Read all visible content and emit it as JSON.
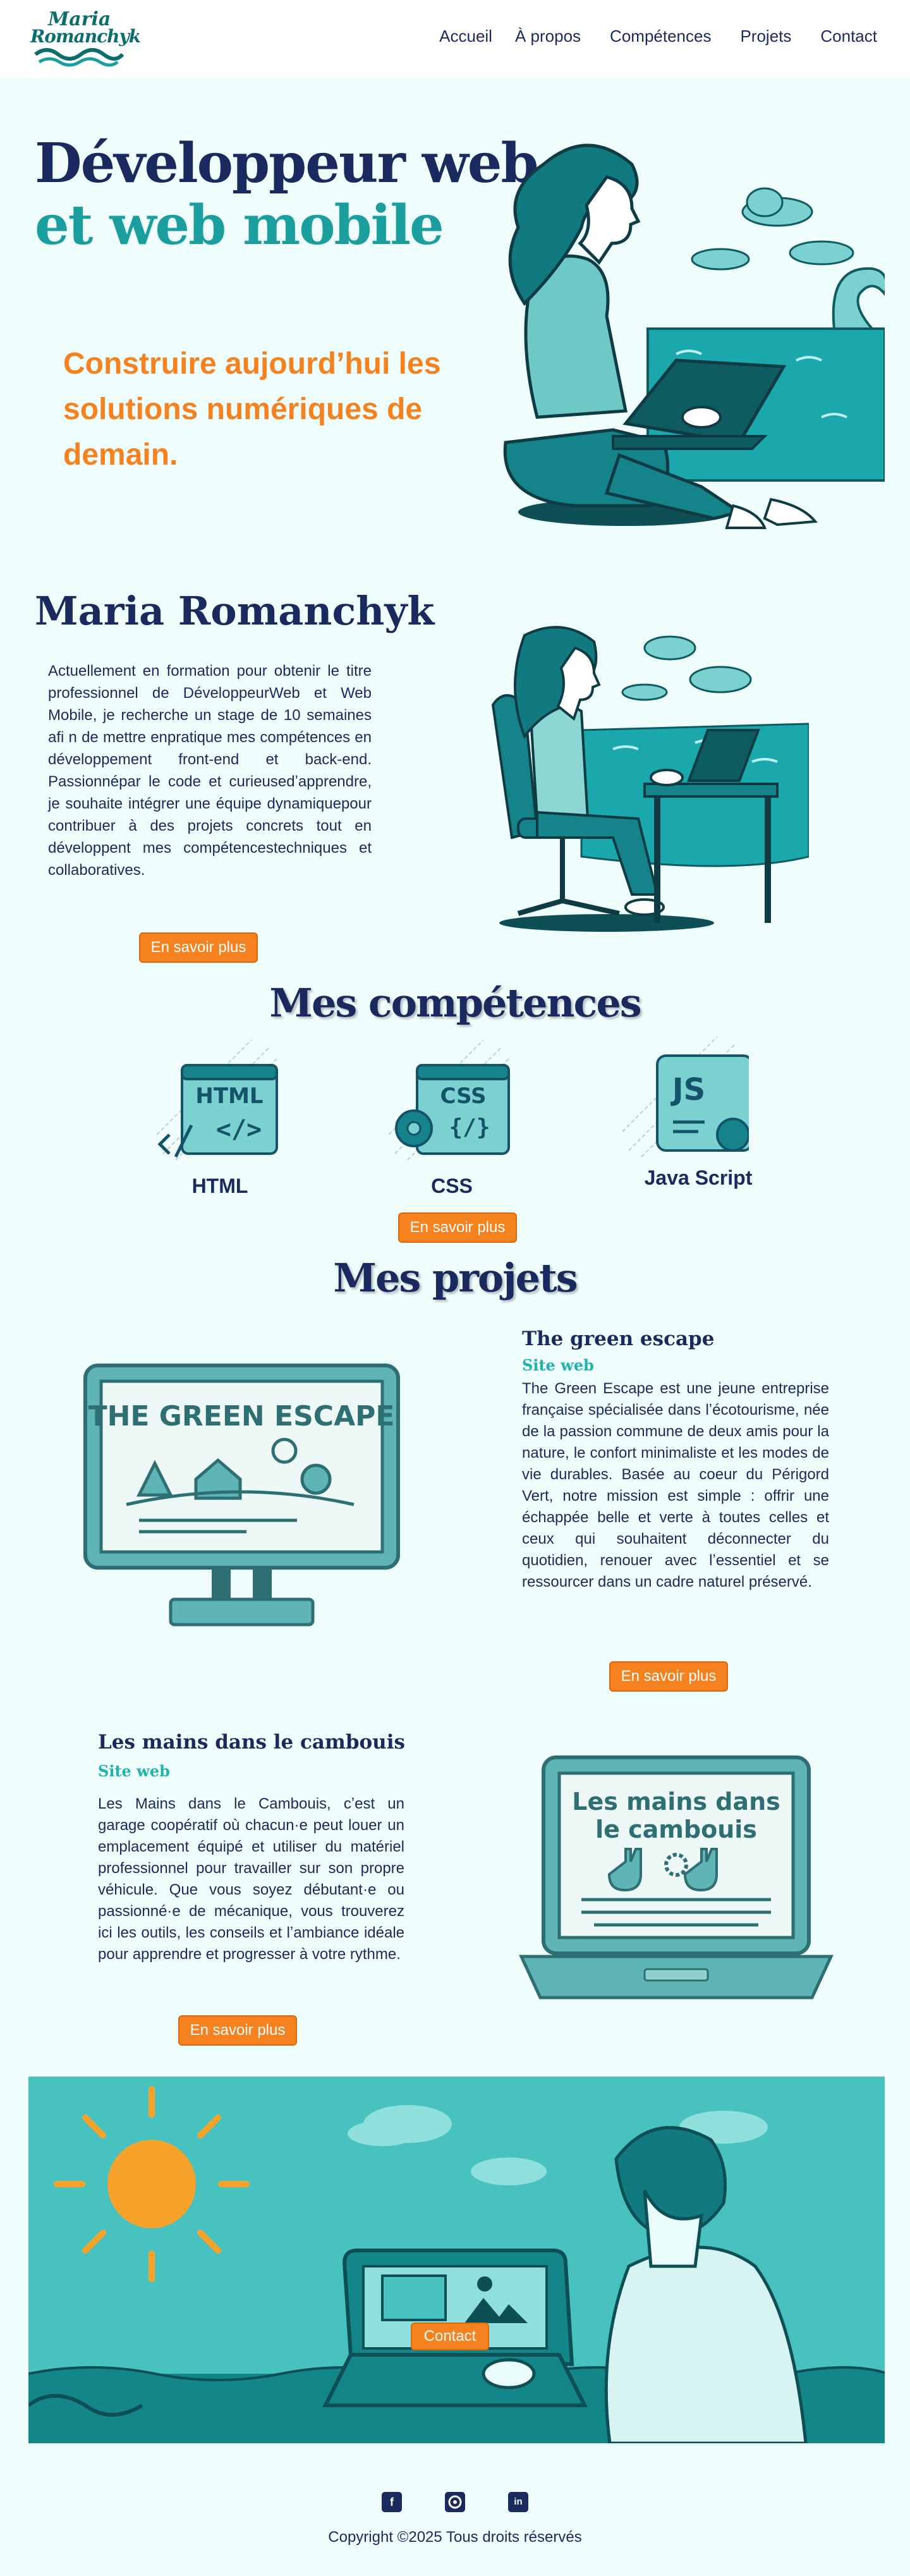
{
  "header": {
    "logo_line1": "Maria",
    "logo_line2": "Romanchyk",
    "nav": [
      "Accueil",
      "À propos",
      "Compétences",
      "Projets",
      "Contact"
    ]
  },
  "hero": {
    "title_line1": "Développeur web",
    "title_line2": "et web mobile",
    "subtitle": "Construire aujourd’hui les solutions numériques de demain."
  },
  "about": {
    "name": "Maria Romanchyk",
    "text": "Actuellement en formation pour obtenir le titre professionnel de DéveloppeurWeb et Web Mobile, je recherche un stage de 10 semaines afi n de mettre enpratique mes compétences en développement front-end et back-end. Passionnépar le code et curieusedʼapprendre, je souhaite intégrer une équipe dynamiquepour contribuer à des projets concrets tout en développent mes compétencestechniques et collaboratives.",
    "button": "En savoir plus"
  },
  "skills": {
    "title": "Mes compétences",
    "items": [
      {
        "label": "HTML",
        "icon_text": "HTML",
        "icon_code": "</>"
      },
      {
        "label": "CSS",
        "icon_text": "CSS",
        "icon_code": "{/}"
      },
      {
        "label": "Java Script",
        "icon_text": "JS"
      }
    ],
    "button": "En savoir plus"
  },
  "projects": {
    "title": "Mes projets",
    "items": [
      {
        "title": "The green escape",
        "subtitle": "Site web",
        "text": "The Green Escape est une jeune entreprise française spécialisée dans lʼécotourisme, née de la passion commune de deux amis pour la nature, le confort minimaliste et les modes de vie durables. Basée au coeur du Périgord Vert, notre mission est simple : offrir une échappée belle et verte à toutes celles et ceux qui souhaitent déconnecter du quotidien, renouer avec lʼessentiel et se ressourcer dans un cadre naturel préservé.",
        "button": "En savoir plus",
        "screen_text": "THE GREEN ESCAPE"
      },
      {
        "title": "Les mains dans le cambouis",
        "subtitle": "Site web",
        "text": "Les Mains dans le Cambouis, cʼest un garage coopératif où chacun·e peut louer un emplacement équipé et utiliser du matériel professionnel pour travailler sur son propre véhicule. Que vous soyez débutant·e ou passionné·e de mécanique, vous trouverez ici les outils, les conseils et lʼambiance idéale pour apprendre et progresser à votre rythme.",
        "button": "En savoir plus",
        "screen_text_1": "Les mains dans",
        "screen_text_2": "le cambouis"
      }
    ]
  },
  "contact": {
    "button": "Contact"
  },
  "footer": {
    "icons": [
      "facebook-icon",
      "github-icon",
      "linkedin-icon"
    ],
    "copyright": "Copyright ©2025 Tous droits réservés"
  },
  "colors": {
    "accent": "#f5821f",
    "teal": "#1a9f9e",
    "navy": "#1b2a5e",
    "bg": "#effdfc"
  }
}
